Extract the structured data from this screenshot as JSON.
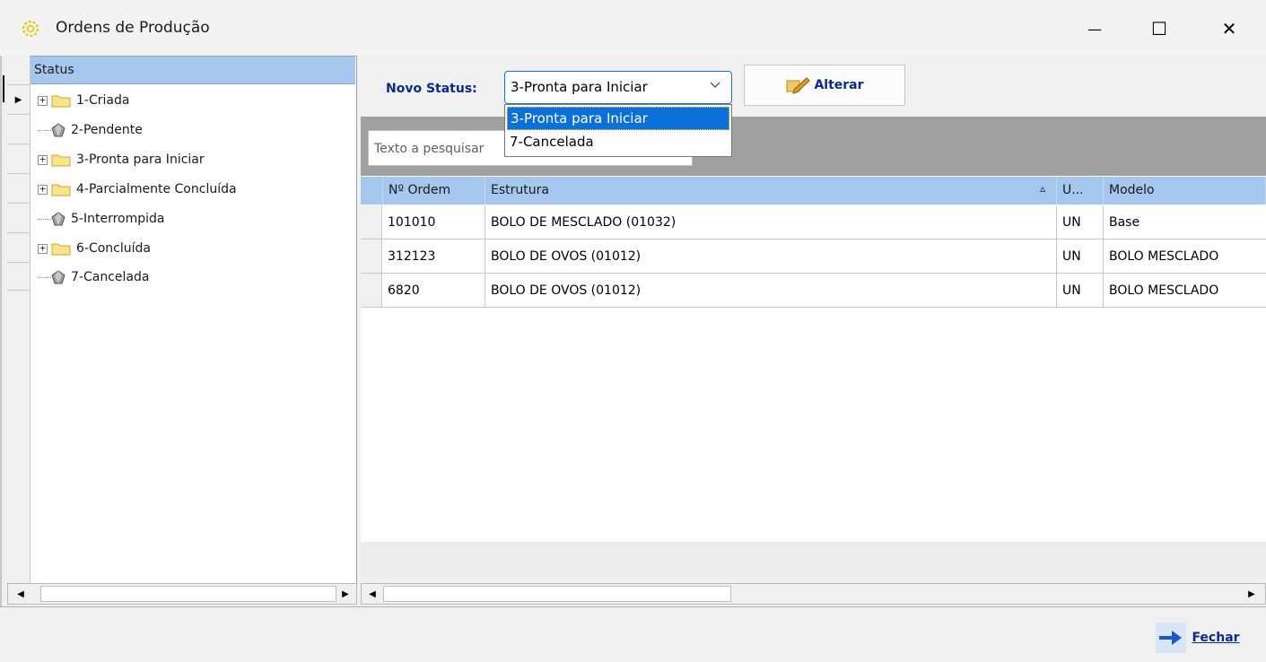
{
  "window": {
    "title": "Ordens de Produção",
    "minimize_glyph": "—",
    "maximize_glyph": "☐",
    "close_glyph": "✕"
  },
  "tree": {
    "header": "Status",
    "items": [
      {
        "label": "1-Criada",
        "icon": "folder-icon",
        "expandable": true
      },
      {
        "label": "2-Pendente",
        "icon": "gem-icon",
        "expandable": false
      },
      {
        "label": "3-Pronta para Iniciar",
        "icon": "folder-icon",
        "expandable": true
      },
      {
        "label": "4-Parcialmente Concluída",
        "icon": "folder-icon",
        "expandable": true
      },
      {
        "label": "5-Interrompida",
        "icon": "gem-icon",
        "expandable": false
      },
      {
        "label": "6-Concluída",
        "icon": "folder-icon",
        "expandable": true
      },
      {
        "label": "7-Cancelada",
        "icon": "gem-icon",
        "expandable": false
      }
    ]
  },
  "toolbar": {
    "novo_status_label": "Novo Status:",
    "status_value": "3-Pronta para Iniciar",
    "alterar_label": "Alterar"
  },
  "dropdown": {
    "options": [
      "3-Pronta para Iniciar",
      "7-Cancelada"
    ],
    "selected": "3-Pronta para Iniciar"
  },
  "search": {
    "placeholder": "Texto a pesquisar"
  },
  "grid": {
    "columns": [
      "Nº Ordem",
      "Estrutura",
      "U...",
      "Modelo"
    ],
    "sort_glyph": "▵",
    "rows": [
      {
        "ordem": "101010",
        "estrutura": "BOLO DE MESCLADO  (01032)",
        "u": "UN",
        "modelo": "Base"
      },
      {
        "ordem": "312123",
        "estrutura": "BOLO DE OVOS  (01012)",
        "u": "UN",
        "modelo": "BOLO MESCLADO"
      },
      {
        "ordem": "6820",
        "estrutura": "BOLO DE OVOS  (01012)",
        "u": "UN",
        "modelo": "BOLO MESCLADO"
      }
    ]
  },
  "footer": {
    "fechar_label": "Fechar"
  },
  "colors": {
    "header_blue": "#a5c7ee",
    "accent_text": "#0b2a8a",
    "selection": "#0b71d9"
  }
}
